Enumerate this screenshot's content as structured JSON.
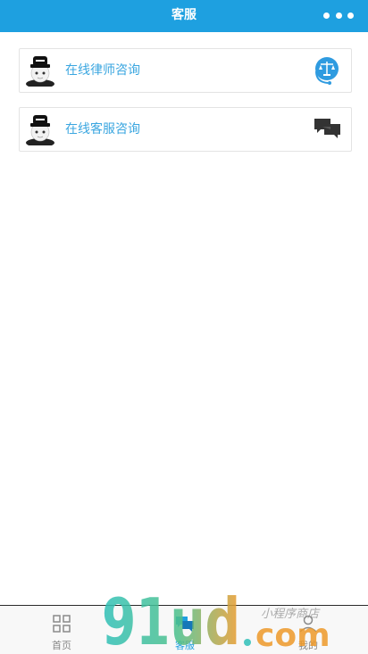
{
  "nav": {
    "title": "客服"
  },
  "items": [
    {
      "label": "在线律师咨询",
      "icon": "scales-headset-icon"
    },
    {
      "label": "在线客服咨询",
      "icon": "chat-bubbles-icon"
    }
  ],
  "tabbar": [
    {
      "label": "首页",
      "icon": "grid-icon"
    },
    {
      "label": "客服",
      "icon": "chat-icon",
      "active": true
    },
    {
      "label": "我的",
      "icon": "user-icon"
    }
  ],
  "watermark": {
    "text": "91ud.com",
    "sub": "小程序商店"
  },
  "colors": {
    "primary": "#1ea0e0",
    "link": "#3aa6e0"
  }
}
